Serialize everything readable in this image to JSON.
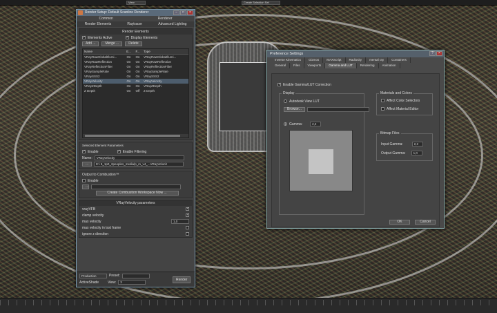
{
  "toolbar": {
    "view_label": "View",
    "selection_label": "Create Selection Set"
  },
  "render_setup": {
    "title": "Render Setup: Default Scanline Renderer",
    "tabs_top": [
      "Common",
      "Renderer"
    ],
    "tabs_bottom": [
      "Render Elements",
      "Raytracer",
      "Advanced Lighting"
    ],
    "render_elements": {
      "header": "Render Elements",
      "elements_active_label": "Elements Active",
      "display_elements_label": "Display Elements",
      "add_label": "Add ...",
      "merge_label": "Merge ...",
      "delete_label": "Delete",
      "columns": [
        "Name",
        "E...",
        "F...",
        "Type"
      ],
      "rows": [
        {
          "name": "VRayRawGlobalIllumi...",
          "e": "On",
          "f": "On",
          "type": "VRayRawGlobalIllumi..."
        },
        {
          "name": "VRayRawReflection",
          "e": "On",
          "f": "On",
          "type": "VRayRawReflection"
        },
        {
          "name": "VRayReflectionFilter",
          "e": "On",
          "f": "On",
          "type": "VRayReflectionFilter"
        },
        {
          "name": "VRaySampleRate",
          "e": "On",
          "f": "On",
          "type": "VRaySampleRate"
        },
        {
          "name": "VRaySSS2",
          "e": "On",
          "f": "On",
          "type": "VRaySSS2"
        },
        {
          "name": "VRayVelocity",
          "e": "On",
          "f": "On",
          "type": "VRayVelocity"
        },
        {
          "name": "VRayZDepth",
          "e": "On",
          "f": "On",
          "type": "VRayZDepth"
        },
        {
          "name": "Z Depth",
          "e": "On",
          "f": "Off",
          "type": "Z Depth"
        }
      ]
    },
    "selected_params": {
      "header": "Selected Element Parameters",
      "enable_label": "Enable",
      "enable_filtering_label": "Enable Filtering",
      "name_label": "Name:",
      "name_value": "VRayVelocity",
      "path_button": "...",
      "path_value": "E:\\ 5_1p0_2peoples_media\\p_m_v4_...VRayVelocit"
    },
    "combustion": {
      "header": "Output to Combustion™",
      "enable_label": "Enable",
      "create_label": "Create Combustion Workspace Now ..."
    },
    "vray_velocity": {
      "header": "VRayVelocity parameters",
      "params": [
        {
          "label": "vrayVFB",
          "value": ""
        },
        {
          "label": "clamp velocity",
          "value": ""
        },
        {
          "label": "max velocity",
          "value": "1,0"
        },
        {
          "label": "max velocity in last frame",
          "value": ""
        },
        {
          "label": "ignore z direction",
          "value": ""
        }
      ]
    },
    "footer": {
      "production_value": "Production",
      "preset_label": "Preset:",
      "activeshade_label": "ActiveShade",
      "view_label": "View:",
      "view_value": "3",
      "render_label": "Render"
    }
  },
  "preference": {
    "title": "Preference Settings",
    "tabs_row1": [
      "Inverse Kinematics",
      "Gizmos",
      "MAXScript",
      "Radiosity",
      "mental ray",
      "Containers"
    ],
    "tabs_row2": [
      "General",
      "Files",
      "Viewports",
      "Gamma and LUT",
      "Rendering",
      "Animation"
    ],
    "active_tab": "Gamma and LUT",
    "enable_gamma_label": "Enable Gamma/LUT Correction",
    "display": {
      "title": "Display",
      "autodesk_lut_label": "Autodesk View LUT",
      "browse_label": "Browse...",
      "gamma_label": "Gamma:",
      "gamma_value": "2,2"
    },
    "materials": {
      "title": "Materials and Colors",
      "affect_color_label": "Affect Color Selectors",
      "affect_material_label": "Affect Material Editor"
    },
    "bitmap": {
      "title": "Bitmap Files",
      "input_label": "Input Gamma:",
      "input_value": "2,2",
      "output_label": "Output Gamma:",
      "output_value": "1,0"
    },
    "ok_label": "OK",
    "cancel_label": "Cancel"
  }
}
